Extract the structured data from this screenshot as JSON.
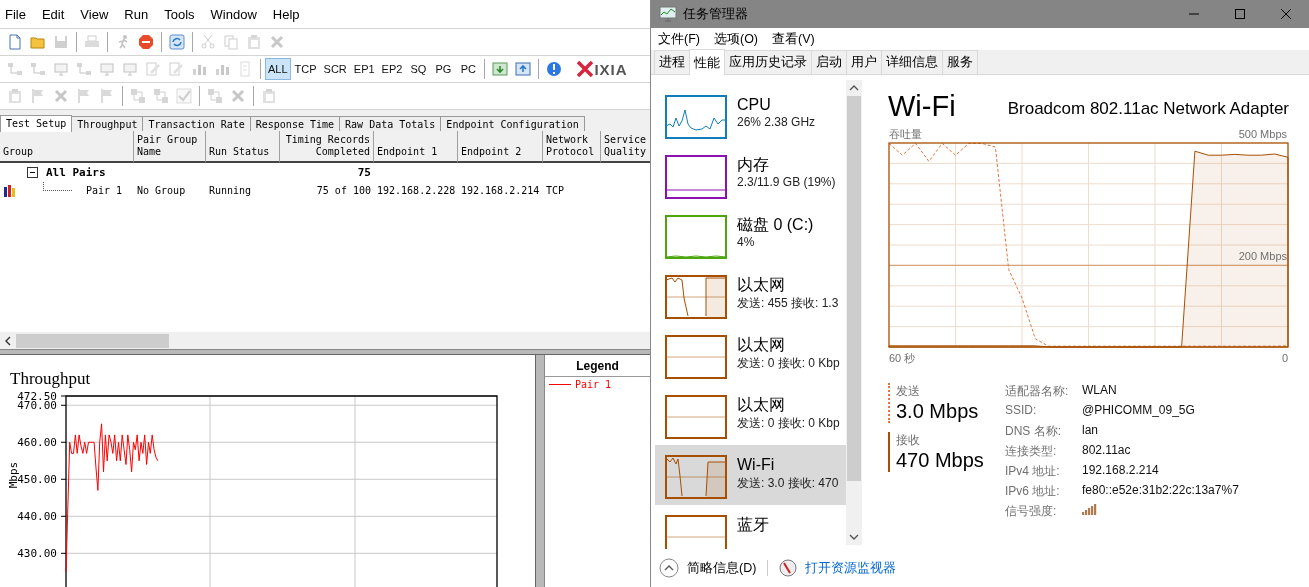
{
  "chariot": {
    "menu": [
      "File",
      "Edit",
      "View",
      "Run",
      "Tools",
      "Window",
      "Help"
    ],
    "toolbars": [
      {
        "items": [
          {
            "kind": "icon",
            "disabled": false
          },
          {
            "kind": "icon",
            "disabled": false
          },
          {
            "kind": "icon",
            "disabled": true
          },
          {
            "kind": "separator"
          },
          {
            "kind": "icon",
            "disabled": true
          },
          {
            "kind": "separator"
          },
          {
            "kind": "icon",
            "disabled": true
          },
          {
            "kind": "icon",
            "disabled": false
          },
          {
            "kind": "separator"
          },
          {
            "kind": "icon",
            "disabled": false
          },
          {
            "kind": "separator"
          },
          {
            "kind": "icon",
            "disabled": true
          },
          {
            "kind": "icon",
            "disabled": true
          },
          {
            "kind": "icon",
            "disabled": true
          },
          {
            "kind": "icon",
            "disabled": true
          }
        ]
      },
      {
        "items": [
          {
            "kind": "icon",
            "disabled": true
          },
          {
            "kind": "icon",
            "disabled": true
          },
          {
            "kind": "icon",
            "disabled": true
          },
          {
            "kind": "icon",
            "disabled": true
          },
          {
            "kind": "icon",
            "disabled": true
          },
          {
            "kind": "icon",
            "disabled": true
          },
          {
            "kind": "icon",
            "disabled": true
          },
          {
            "kind": "icon",
            "disabled": true
          },
          {
            "kind": "icon",
            "disabled": true
          },
          {
            "kind": "icon",
            "disabled": true
          },
          {
            "kind": "icon",
            "disabled": true
          },
          {
            "kind": "separator"
          },
          {
            "kind": "text",
            "label": "ALL",
            "selected": true
          },
          {
            "kind": "text",
            "label": "TCP",
            "selected": false
          },
          {
            "kind": "text",
            "label": "SCR",
            "selected": false
          },
          {
            "kind": "text",
            "label": "EP1",
            "selected": false
          },
          {
            "kind": "text",
            "label": "EP2",
            "selected": false
          },
          {
            "kind": "text",
            "label": "SQ",
            "selected": false
          },
          {
            "kind": "text",
            "label": "PG",
            "selected": false
          },
          {
            "kind": "text",
            "label": "PC",
            "selected": false
          },
          {
            "kind": "separator"
          },
          {
            "kind": "icon",
            "disabled": false
          },
          {
            "kind": "icon",
            "disabled": false
          },
          {
            "kind": "separator"
          },
          {
            "kind": "icon",
            "disabled": false
          },
          {
            "kind": "logo",
            "label": "IXIA"
          }
        ]
      },
      {
        "items": [
          {
            "kind": "icon",
            "disabled": true
          },
          {
            "kind": "icon",
            "disabled": true
          },
          {
            "kind": "icon",
            "disabled": true
          },
          {
            "kind": "icon",
            "disabled": true
          },
          {
            "kind": "icon",
            "disabled": true
          },
          {
            "kind": "separator"
          },
          {
            "kind": "icon",
            "disabled": true
          },
          {
            "kind": "icon",
            "disabled": true
          },
          {
            "kind": "icon",
            "disabled": true
          },
          {
            "kind": "separator"
          },
          {
            "kind": "icon",
            "disabled": true
          },
          {
            "kind": "icon",
            "disabled": true
          },
          {
            "kind": "separator"
          },
          {
            "kind": "icon",
            "disabled": true
          }
        ]
      }
    ],
    "tabs": [
      {
        "label": "Test Setup",
        "selected": true
      },
      {
        "label": "Throughput",
        "selected": false
      },
      {
        "label": "Transaction Rate",
        "selected": false
      },
      {
        "label": "Response Time",
        "selected": false
      },
      {
        "label": "Raw Data Totals",
        "selected": false
      },
      {
        "label": "Endpoint Configuration",
        "selected": false
      }
    ],
    "table": {
      "columns": [
        "Group",
        "Pair Group Name",
        "Run Status",
        "Timing Records Completed",
        "Endpoint 1",
        "Endpoint 2",
        "Network Protocol",
        "Service Quality"
      ],
      "rows": [
        {
          "kind": "group",
          "expanded": true,
          "name": "All Pairs",
          "timing_records": "75"
        },
        {
          "kind": "pair",
          "name": "Pair 1",
          "pair_group_name": "No Group",
          "run_status": "Running",
          "timing_records": "75 of 100",
          "endpoint_1": "192.168.2.228",
          "endpoint_2": "192.168.2.214",
          "network_protocol": "TCP"
        }
      ]
    },
    "chart": {
      "chart_data": {
        "type": "line",
        "title": "Throughput",
        "ylabel": "Mbps",
        "grid": true,
        "categories": [
          null,
          null,
          null,
          null,
          null,
          null,
          null,
          null,
          null,
          null,
          null,
          null,
          null,
          null,
          null,
          null,
          null,
          null,
          null,
          null,
          null,
          null,
          null,
          null,
          null,
          null,
          null,
          null,
          null,
          null,
          null,
          null,
          null,
          null,
          null,
          null,
          null,
          null,
          null,
          null,
          null,
          null,
          null,
          null,
          null,
          null,
          null,
          null,
          null,
          null,
          null,
          null,
          null,
          null,
          null,
          null,
          null,
          null,
          null,
          null,
          null,
          null,
          null,
          null,
          null,
          null,
          null,
          null,
          null,
          null,
          null,
          null,
          null,
          null,
          null,
          null,
          null,
          null,
          null,
          null,
          null,
          null,
          null,
          null,
          null,
          null,
          null,
          null,
          null,
          null,
          null,
          null,
          null,
          null,
          null,
          null,
          null,
          null,
          null,
          null,
          null,
          null,
          null,
          null,
          null,
          null,
          null,
          null,
          null,
          null,
          null,
          null,
          null,
          null,
          null,
          null,
          null,
          null,
          null,
          null,
          null,
          null,
          null,
          null,
          null,
          null,
          null,
          null,
          null,
          null,
          null,
          null,
          null,
          null,
          null,
          null,
          null,
          null,
          null,
          null,
          null,
          null,
          null,
          null,
          null,
          null,
          null,
          null,
          null,
          null,
          null,
          null,
          null,
          null,
          null,
          null,
          null,
          null,
          null,
          null,
          null,
          null,
          null,
          null,
          null,
          null,
          null,
          null,
          null,
          null,
          null,
          null,
          null,
          null,
          null,
          null,
          null,
          null,
          null,
          null,
          null,
          null,
          null,
          null,
          null,
          null,
          null,
          null,
          null,
          null,
          null,
          null,
          null,
          null,
          null,
          null,
          null,
          null,
          null,
          null,
          null,
          null,
          null,
          null,
          null,
          null,
          null,
          null,
          null,
          null,
          null,
          null,
          null,
          null,
          null,
          null,
          null,
          null,
          null,
          null,
          null,
          null,
          null,
          null,
          null,
          null,
          null,
          null,
          null,
          null,
          null
        ],
        "ylim": [
          420.9,
          472.5
        ],
        "yticks": [
          {
            "value": 472.5,
            "label": "472.50"
          },
          {
            "value": 470,
            "label": "470.00"
          },
          {
            "value": 460,
            "label": "460.00"
          },
          {
            "value": 450,
            "label": "450.00"
          },
          {
            "value": 440,
            "label": "440.00"
          },
          {
            "value": 430,
            "label": "430.00"
          }
        ],
        "series": [
          {
            "name": "Pair 1",
            "color": "#ff0000",
            "values": [
              425,
              443,
              460,
              457,
              457,
              462,
              457,
              462,
              459,
              457,
              460,
              457,
              460,
              460,
              460,
              460,
              453,
              447,
              460,
              465,
              452,
              462,
              455,
              462,
              460,
              457,
              462,
              455,
              460,
              455,
              462,
              458,
              454,
              462,
              458,
              452,
              460,
              458,
              462,
              455,
              460,
              457,
              462,
              454,
              460,
              457,
              462,
              458,
              456,
              455,
              null,
              null,
              null,
              null,
              null,
              null,
              null,
              null,
              null,
              null,
              null,
              null,
              null,
              null,
              null,
              null,
              null,
              null,
              null,
              null,
              null,
              null,
              null,
              null,
              null,
              null,
              null,
              null,
              null,
              null,
              null,
              null,
              null,
              null,
              null,
              null,
              null,
              null,
              null,
              null,
              null,
              null,
              null,
              null,
              null,
              null,
              null,
              null,
              null,
              null,
              null,
              null,
              null,
              null,
              null,
              null,
              null,
              null,
              null,
              null,
              null,
              null,
              null,
              null,
              null,
              null,
              null,
              null,
              null,
              null,
              null,
              null,
              null,
              null,
              null,
              null,
              null,
              null,
              null,
              null,
              null,
              null,
              null,
              null,
              null,
              null,
              null,
              null,
              null,
              null,
              null,
              null,
              null,
              null,
              null,
              null,
              null,
              null,
              null,
              null,
              null,
              null,
              null,
              null,
              null,
              null,
              null,
              null,
              null,
              null,
              null,
              null,
              null,
              null,
              null,
              null,
              null,
              null,
              null,
              null,
              null,
              null,
              null,
              null,
              null,
              null,
              null,
              null,
              null,
              null,
              null,
              null,
              null,
              null,
              null,
              null,
              null,
              null,
              null,
              null,
              null,
              null,
              null,
              null,
              null,
              null,
              null,
              null,
              null,
              null,
              null,
              null,
              null,
              null,
              null,
              null,
              null,
              null,
              null,
              null,
              null,
              null,
              null,
              null,
              null,
              null,
              null,
              null,
              null,
              null,
              null,
              null,
              null,
              null,
              null,
              null,
              null,
              null,
              null,
              null,
              null
            ]
          }
        ]
      }
    },
    "legend": {
      "title": "Legend"
    }
  },
  "task_manager": {
    "title": "任务管理器",
    "menu": [
      "文件(F)",
      "选项(O)",
      "查看(V)"
    ],
    "tabs": [
      {
        "label": "进程",
        "selected": false
      },
      {
        "label": "性能",
        "selected": true
      },
      {
        "label": "应用历史记录",
        "selected": false
      },
      {
        "label": "启动",
        "selected": false
      },
      {
        "label": "用户",
        "selected": false
      },
      {
        "label": "详细信息",
        "selected": false
      },
      {
        "label": "服务",
        "selected": false
      }
    ],
    "resources": [
      {
        "name": "CPU",
        "detail": "26% 2.38 GHz",
        "color": "#117dbb",
        "selected": false
      },
      {
        "name": "内存",
        "detail": "2.3/11.9 GB (19%)",
        "color": "#8b12ae",
        "selected": false
      },
      {
        "name": "磁盘 0 (C:)",
        "detail": "4%",
        "color": "#4da60c",
        "selected": false
      },
      {
        "name": "以太网",
        "detail": "发送: 455 接收: 1.3",
        "color": "#a74f01",
        "selected": false
      },
      {
        "name": "以太网",
        "detail": "发送: 0 接收: 0 Kbp",
        "color": "#a74f01",
        "selected": false
      },
      {
        "name": "以太网",
        "detail": "发送: 0 接收: 0 Kbp",
        "color": "#a74f01",
        "selected": false
      },
      {
        "name": "Wi-Fi",
        "detail": "发送: 3.0 接收: 470",
        "color": "#a74f01",
        "selected": true
      },
      {
        "name": "蓝牙",
        "color": "#a74f01",
        "selected": false
      }
    ],
    "detail": {
      "name": "Wi-Fi",
      "adapter": "Broadcom 802.11ac Network Adapter",
      "graph": {
        "label": "吞吐量",
        "scale_max": "500 Mbps",
        "scale_mark": "200 Mbps",
        "time_start": "60 秒",
        "time_end": "0"
      },
      "send": {
        "label": "发送",
        "value": "3.0 Mbps"
      },
      "receive": {
        "label": "接收",
        "value": "470 Mbps"
      },
      "properties": [
        {
          "kind": "text",
          "label": "适配器名称:",
          "value": "WLAN"
        },
        {
          "kind": "text",
          "label": "SSID:",
          "value": "@PHICOMM_09_5G"
        },
        {
          "kind": "text",
          "label": "DNS 名称:",
          "value": "lan"
        },
        {
          "kind": "text",
          "label": "连接类型:",
          "value": "802.11ac"
        },
        {
          "kind": "text",
          "label": "IPv4 地址:",
          "value": "192.168.2.214"
        },
        {
          "kind": "text",
          "label": "IPv6 地址:",
          "value": "fe80::e52e:31b2:22c:13a7%7"
        },
        {
          "kind": "signal",
          "label": "信号强度:"
        }
      ]
    },
    "footer": {
      "fewer_details": "简略信息(D)",
      "resource_monitor": "打开资源监视器"
    }
  }
}
